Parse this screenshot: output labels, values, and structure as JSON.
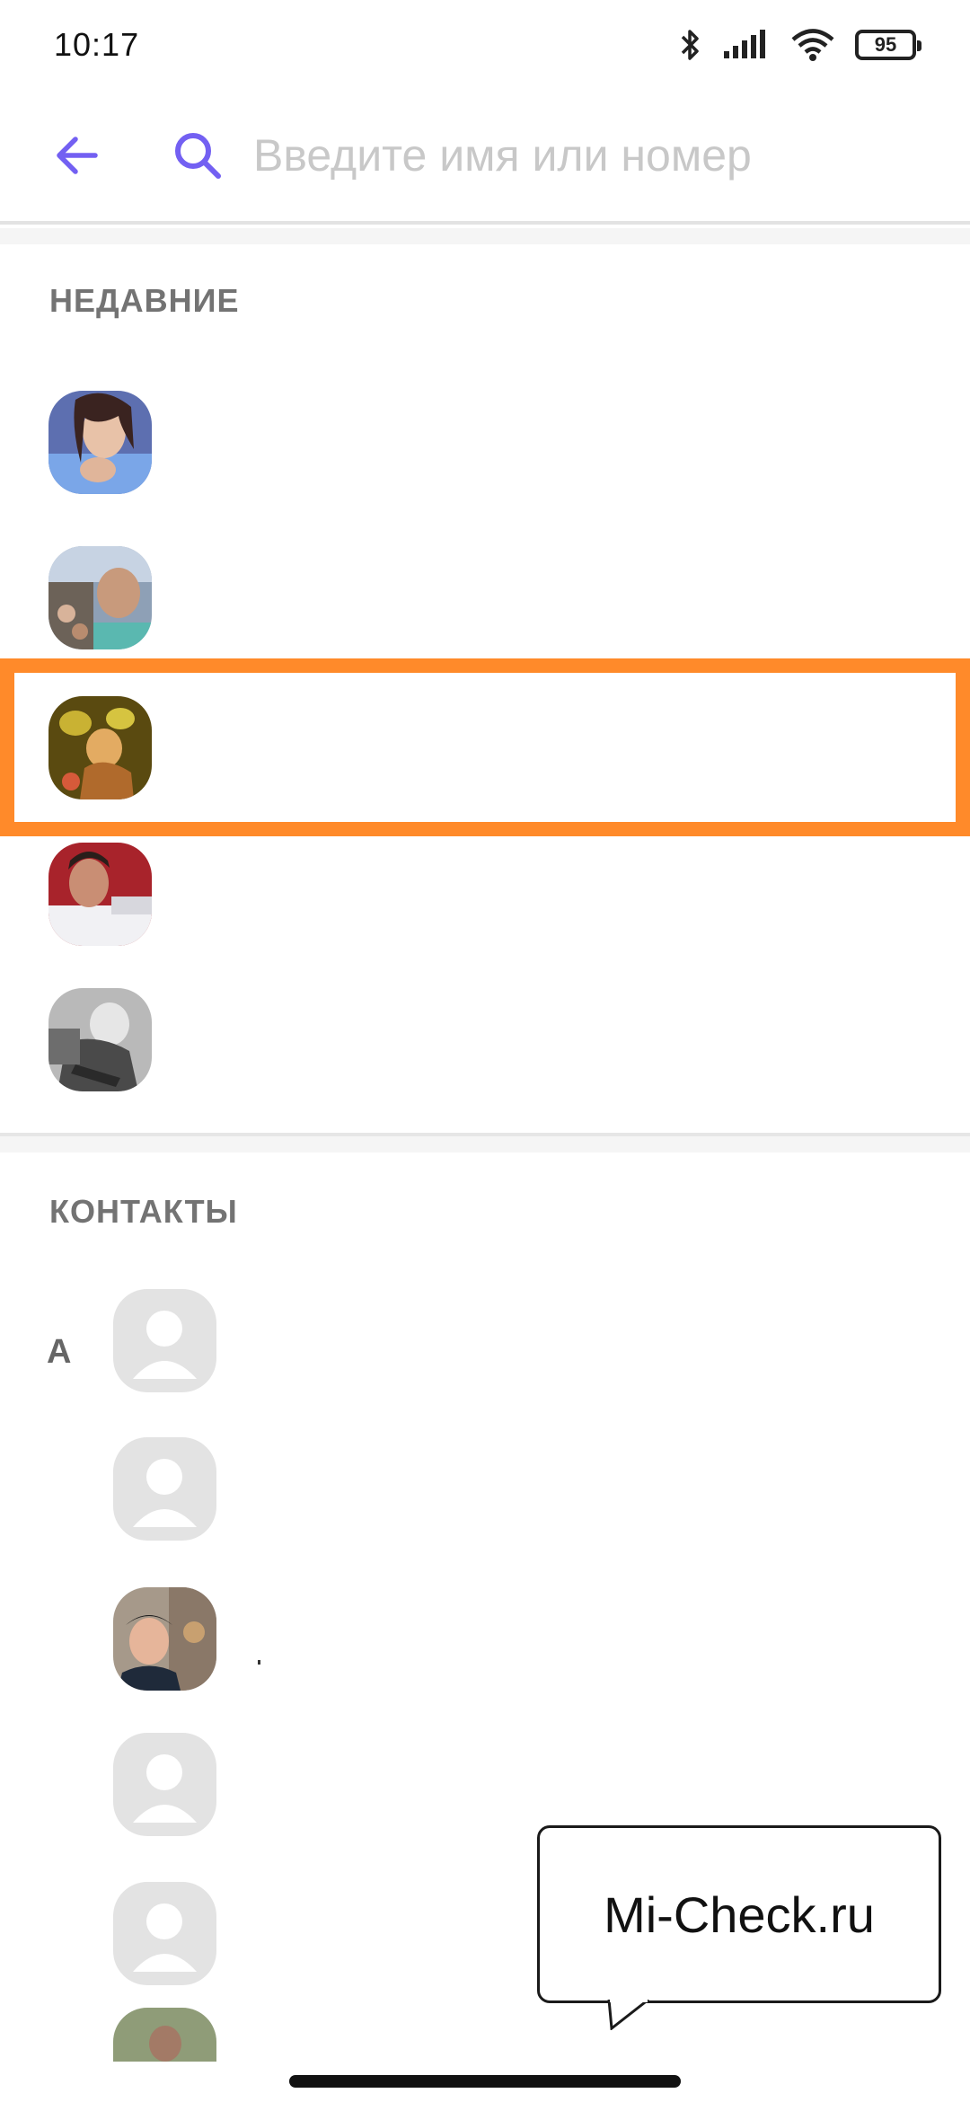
{
  "status": {
    "time": "10:17",
    "battery": "95",
    "icons": [
      "bluetooth-icon",
      "signal-icon",
      "wifi-icon",
      "battery-icon"
    ]
  },
  "search": {
    "placeholder": "Введите имя или номер",
    "value": ""
  },
  "sections": {
    "recent_title": "НЕДАВНИЕ",
    "contacts_title": "КОНТАКТЫ"
  },
  "recent_contacts": [
    {
      "name": "",
      "avatar": "photo"
    },
    {
      "name": "",
      "avatar": "photo"
    },
    {
      "name": "",
      "avatar": "photo",
      "highlighted": true
    },
    {
      "name": "",
      "avatar": "photo"
    },
    {
      "name": "",
      "avatar": "photo"
    }
  ],
  "contacts": [
    {
      "letter": "A",
      "name": "",
      "avatar": "placeholder"
    },
    {
      "letter": "",
      "name": "",
      "avatar": "placeholder"
    },
    {
      "letter": "",
      "name": "",
      "avatar": "photo"
    },
    {
      "letter": "",
      "name": "",
      "avatar": "placeholder"
    },
    {
      "letter": "",
      "name": "",
      "avatar": "placeholder"
    },
    {
      "letter": "",
      "name": "",
      "avatar": "photo"
    }
  ],
  "watermark": {
    "text": "Mi-Check.ru"
  },
  "colors": {
    "accent": "#7360f2",
    "highlight": "#ff8a2a",
    "section_title": "#737373",
    "placeholder": "#c8c8c8"
  }
}
